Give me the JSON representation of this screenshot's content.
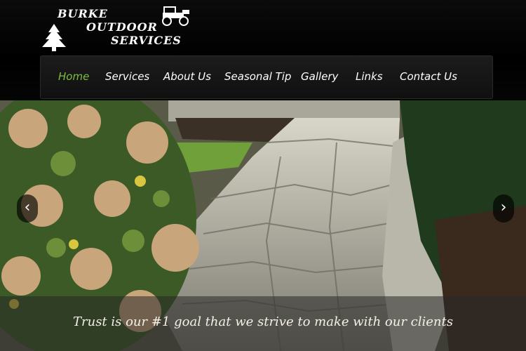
{
  "brand": {
    "line1": "Burke",
    "line2": "Outdoor",
    "line3": "Services"
  },
  "nav": {
    "items": [
      {
        "label": "Home",
        "active": true
      },
      {
        "label": "Services"
      },
      {
        "label": "About Us"
      },
      {
        "label": "Seasonal Tip"
      },
      {
        "label": "Gallery"
      },
      {
        "label": "Links"
      },
      {
        "label": "Contact Us"
      }
    ]
  },
  "slider": {
    "prev_icon": "‹",
    "next_icon": "›",
    "caption": "Trust is our #1 goal that we strive to make with our clients"
  },
  "colors": {
    "active_nav": "#7cbf3b",
    "background": "#000000"
  }
}
